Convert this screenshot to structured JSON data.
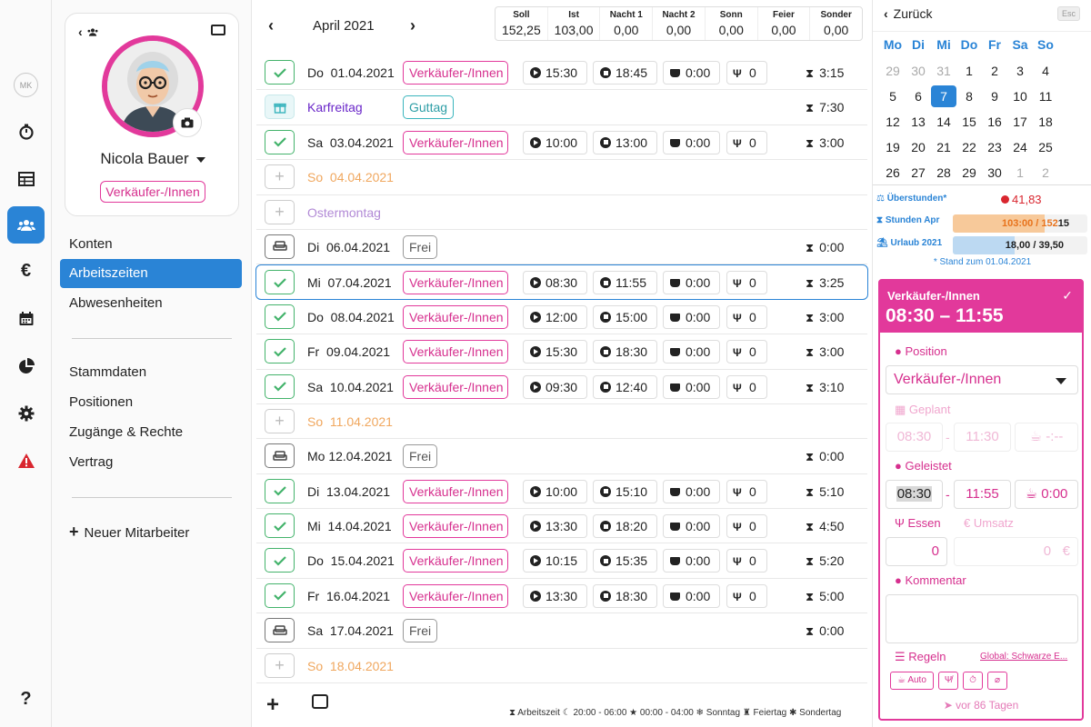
{
  "rail": {
    "initials": "MK",
    "icons": [
      "stopwatch-icon",
      "table-icon",
      "users-icon",
      "euro-icon",
      "calendar-icon",
      "pie-chart-icon",
      "gear-icon",
      "warning-icon",
      "help-icon"
    ]
  },
  "profile": {
    "name": "Nicola Bauer",
    "position": "Verkäufer-/Innen"
  },
  "nav": {
    "konten": "Konten",
    "arbeitszeiten": "Arbeitszeiten",
    "abwesenheiten": "Abwesenheiten",
    "stammdaten": "Stammdaten",
    "positionen": "Positionen",
    "zugaenge": "Zugänge & Rechte",
    "vertrag": "Vertrag",
    "new_employee": "Neuer Mitarbeiter"
  },
  "header": {
    "prev": "‹",
    "next": "›",
    "month": "April 2021",
    "stats": [
      {
        "label": "Soll",
        "value": "152,25"
      },
      {
        "label": "Ist",
        "value": "103,00"
      },
      {
        "label": "Nacht 1",
        "value": "0,00"
      },
      {
        "label": "Nacht 2",
        "value": "0,00"
      },
      {
        "label": "Sonn",
        "value": "0,00"
      },
      {
        "label": "Feier",
        "value": "0,00"
      },
      {
        "label": "Sonder",
        "value": "0,00"
      }
    ]
  },
  "rows": [
    {
      "type": "work",
      "date": "Do  01.04.2021",
      "position": "Verkäufer-/Innen",
      "start": "15:30",
      "end": "18:45",
      "break": "0:00",
      "meals": "0",
      "total": "3:15"
    },
    {
      "type": "holiday",
      "date": "Karfreitag",
      "chip": "Guttag",
      "total": "7:30"
    },
    {
      "type": "work",
      "date": "Sa  03.04.2021",
      "position": "Verkäufer-/Innen",
      "start": "10:00",
      "end": "13:00",
      "break": "0:00",
      "meals": "0",
      "total": "3:00"
    },
    {
      "type": "sunday",
      "date": "So  04.04.2021"
    },
    {
      "type": "easter",
      "date": "Ostermontag"
    },
    {
      "type": "free",
      "date": "Di  06.04.2021",
      "chip": "Frei",
      "total": "0:00"
    },
    {
      "type": "work",
      "selected": true,
      "date": "Mi  07.04.2021",
      "position": "Verkäufer-/Innen",
      "start": "08:30",
      "end": "11:55",
      "break": "0:00",
      "meals": "0",
      "total": "3:25"
    },
    {
      "type": "work",
      "date": "Do  08.04.2021",
      "position": "Verkäufer-/Innen",
      "start": "12:00",
      "end": "15:00",
      "break": "0:00",
      "meals": "0",
      "total": "3:00"
    },
    {
      "type": "work",
      "date": "Fr  09.04.2021",
      "position": "Verkäufer-/Innen",
      "start": "15:30",
      "end": "18:30",
      "break": "0:00",
      "meals": "0",
      "total": "3:00"
    },
    {
      "type": "work",
      "date": "Sa  10.04.2021",
      "position": "Verkäufer-/Innen",
      "start": "09:30",
      "end": "12:40",
      "break": "0:00",
      "meals": "0",
      "total": "3:10"
    },
    {
      "type": "sunday",
      "date": "So  11.04.2021"
    },
    {
      "type": "free",
      "date": "Mo 12.04.2021",
      "chip": "Frei",
      "total": "0:00"
    },
    {
      "type": "work",
      "date": "Di  13.04.2021",
      "position": "Verkäufer-/Innen",
      "start": "10:00",
      "end": "15:10",
      "break": "0:00",
      "meals": "0",
      "total": "5:10"
    },
    {
      "type": "work",
      "date": "Mi  14.04.2021",
      "position": "Verkäufer-/Innen",
      "start": "13:30",
      "end": "18:20",
      "break": "0:00",
      "meals": "0",
      "total": "4:50"
    },
    {
      "type": "work",
      "date": "Do  15.04.2021",
      "position": "Verkäufer-/Innen",
      "start": "10:15",
      "end": "15:35",
      "break": "0:00",
      "meals": "0",
      "total": "5:20"
    },
    {
      "type": "work",
      "date": "Fr  16.04.2021",
      "position": "Verkäufer-/Innen",
      "start": "13:30",
      "end": "18:30",
      "break": "0:00",
      "meals": "0",
      "total": "5:00"
    },
    {
      "type": "free",
      "date": "Sa  17.04.2021",
      "chip": "Frei",
      "total": "0:00"
    },
    {
      "type": "sunday",
      "date": "So  18.04.2021"
    }
  ],
  "legend": "⧗ Arbeitszeit  ☾ 20:00 - 06:00  ★ 00:00 - 04:00  ❄ Sonntag  ♜ Feiertag  ✱ Sondertag",
  "right": {
    "back": "Zurück",
    "esc": "Esc",
    "weekdays": [
      "Mo",
      "Di",
      "Mi",
      "Do",
      "Fr",
      "Sa",
      "So"
    ],
    "weeks": [
      [
        "29",
        "30",
        "31",
        "1",
        "2",
        "3",
        "4"
      ],
      [
        "5",
        "6",
        "7",
        "8",
        "9",
        "10",
        "11"
      ],
      [
        "12",
        "13",
        "14",
        "15",
        "16",
        "17",
        "18"
      ],
      [
        "19",
        "20",
        "21",
        "22",
        "23",
        "24",
        "25"
      ],
      [
        "26",
        "27",
        "28",
        "29",
        "30",
        "1",
        "2"
      ]
    ],
    "today": "7",
    "summary": [
      {
        "label": "Überstunden*",
        "value": "41,83"
      },
      {
        "label": "Stunden Apr",
        "value": "103:00 / 152",
        "suffix": "15",
        "fill": 0.68,
        "color": "#f7c99a"
      },
      {
        "label": "Urlaub 2021",
        "value": "18,00 / 39,50",
        "fill": 0.46,
        "color": "#bcd9f2"
      }
    ],
    "stand": "* Stand zum 01.04.2021",
    "form": {
      "title": "Verkäufer-/Innen",
      "time": "08:30 – 11:55",
      "position_label": "Position",
      "position_value": "Verkäufer-/Innen",
      "geplant_label": "Geplant",
      "plan_start": "08:30",
      "plan_end": "11:30",
      "plan_break": "-:--",
      "geleistet_label": "Geleistet",
      "act_start": "08:30",
      "act_end": "11:55",
      "act_break": "0:00",
      "essen_label": "Essen",
      "umsatz_label": "Umsatz",
      "essen_value": "0",
      "umsatz_value": "0",
      "currency": "€",
      "kommentar_label": "Kommentar",
      "regeln_label": "Regeln",
      "regeln_link": "Global: Schwarze E...",
      "auto_label": "Auto",
      "sent": "vor 86 Tagen"
    }
  }
}
